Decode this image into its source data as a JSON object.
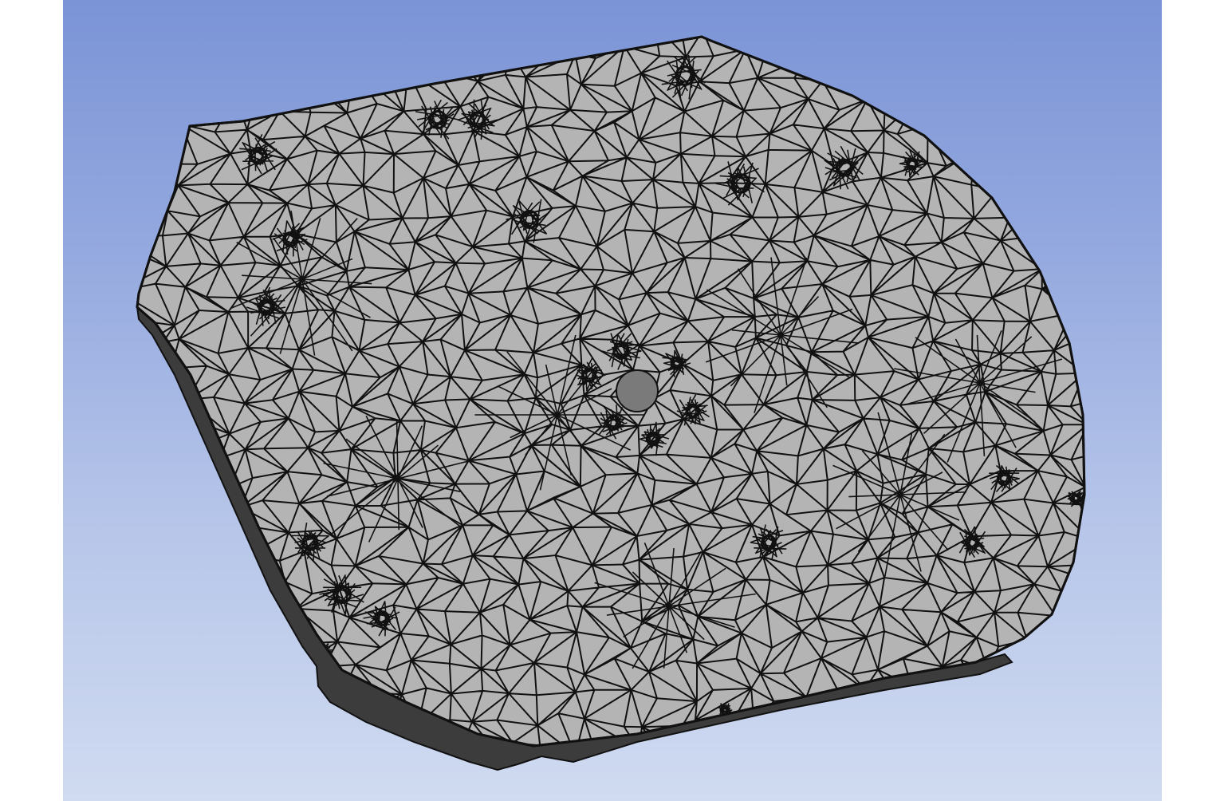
{
  "viewport": {
    "background_top": "#7b94d6",
    "background_bottom": "#d0dbf1"
  },
  "model": {
    "kind": "meshed plate",
    "face_color": "#b4b4b4",
    "edge_color": "#3c3c3c",
    "mesh_line_color": "#111111",
    "mesh_element_shape": "triangle"
  }
}
